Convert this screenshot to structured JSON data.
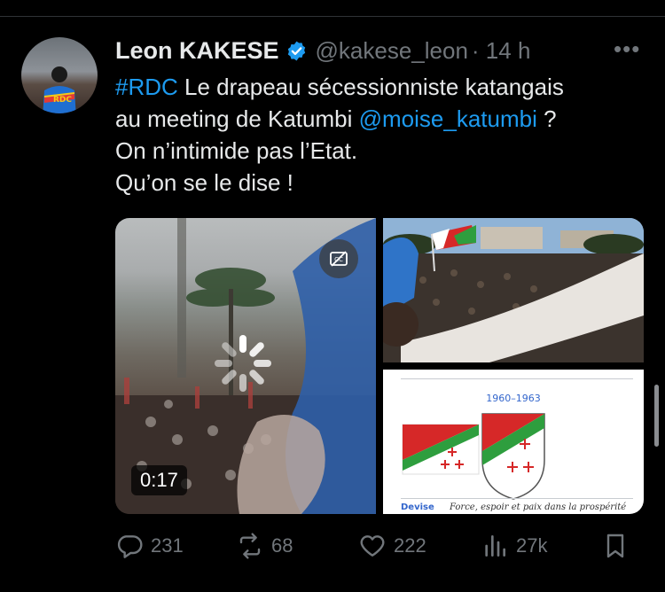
{
  "tweet": {
    "author_name": "Leon KAKESE",
    "handle": "@kakese_leon",
    "time": "· 14 h",
    "more_label": "•••",
    "text": {
      "hashtag": "#RDC",
      "line1_rest": " Le drapeau sécessionniste katangais",
      "line2_start": "au meeting de Katumbi ",
      "mention": "@moise_katumbi",
      "line2_end": " ?",
      "line3": "On n’intimide pas l’Etat.",
      "line4": "Qu’on se le dise !"
    },
    "avatar_badge": "RDC"
  },
  "media": {
    "video_duration": "0:17",
    "flag_panel": {
      "years": "1960–1963",
      "devise_label": "Devise",
      "motto": "Force, espoir et paix dans la prospérité"
    }
  },
  "actions": {
    "replies": "231",
    "reposts": "68",
    "likes": "222",
    "views": "27k"
  },
  "colors": {
    "background": "#000000",
    "text": "#e7e9ea",
    "muted": "#71767b",
    "link": "#1d9bf0",
    "flag_red": "#d62828",
    "flag_green": "#2e9e3e"
  }
}
